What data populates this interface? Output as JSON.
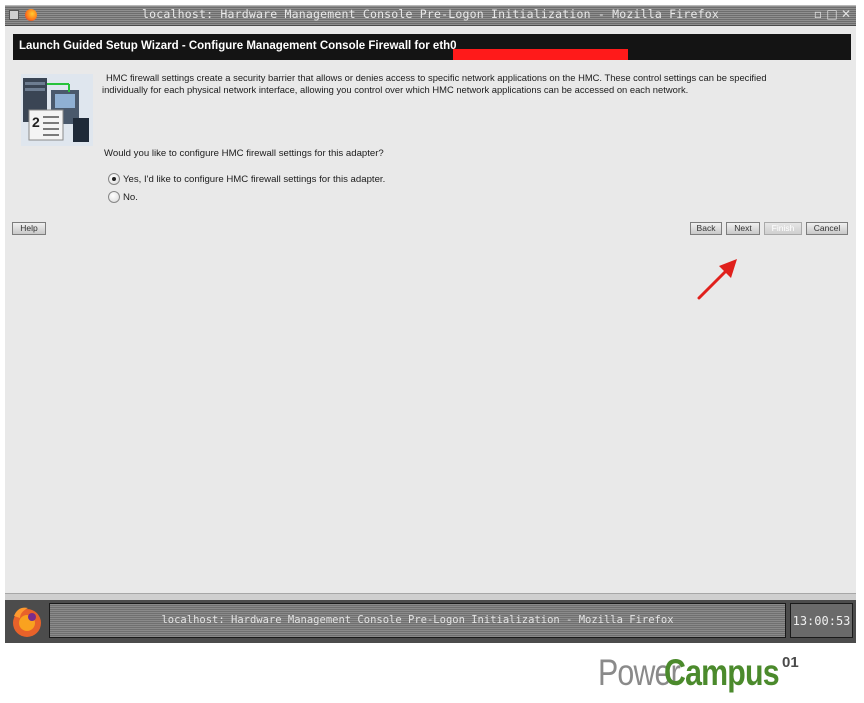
{
  "window": {
    "title": "localhost: Hardware Management Console Pre-Logon Initialization - Mozilla Firefox",
    "controls": [
      "minimize-icon",
      "maximize-icon",
      "close-icon"
    ]
  },
  "wizard": {
    "header": "Launch Guided Setup Wizard - Configure Management Console Firewall for eth0",
    "redaction_color": "#ff1a1a",
    "description_line1": "HMC firewall settings create a security barrier that allows or denies access to specific network applications on the HMC. These control settings can be specified",
    "description_line2": "individually for each physical network interface, allowing you control over which HMC network applications can be accessed on each network.",
    "question": "Would you like to configure HMC firewall settings for this adapter?",
    "options": [
      {
        "label": "Yes, I'd like to configure HMC firewall settings for this adapter.",
        "selected": true
      },
      {
        "label": "No.",
        "selected": false
      }
    ],
    "buttons": {
      "help": "Help",
      "back": "Back",
      "next": "Next",
      "finish": "Finish",
      "cancel": "Cancel"
    },
    "finish_disabled": true
  },
  "taskbar": {
    "window_button": "localhost: Hardware Management Console Pre-Logon Initialization - Mozilla Firefox",
    "clock": "13:00:53"
  },
  "watermark": {
    "part1": "Power",
    "part2": "Campus",
    "part3": "01",
    "color_power": "#8a8a8a",
    "color_campus": "#4b8a2c"
  },
  "colors": {
    "header_bg": "#141414",
    "content_bg": "#e9e9e9",
    "arrow": "#e0201c"
  }
}
